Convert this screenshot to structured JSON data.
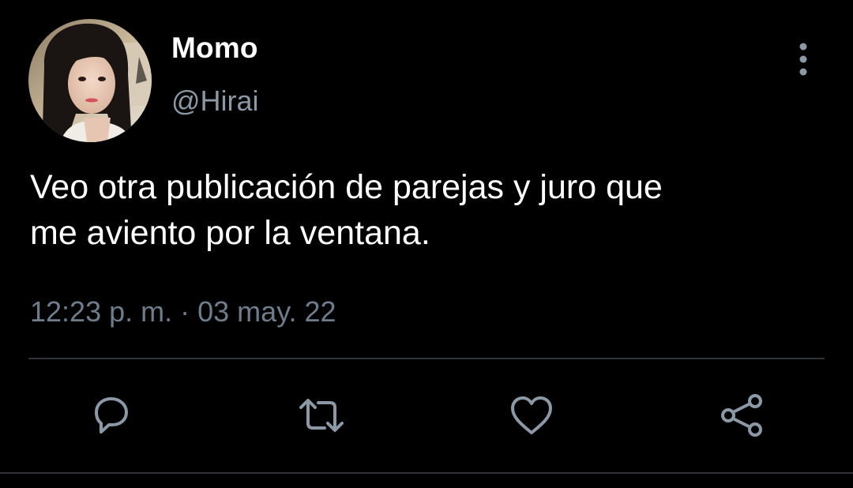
{
  "user": {
    "display_name": "Momo",
    "handle": "@Hirai"
  },
  "tweet": {
    "text": "Veo otra publicación de parejas y juro que\nme aviento por la ventana.",
    "time": "12:23 p. m.",
    "separator": "·",
    "date": "03 may. 22"
  },
  "actions": [
    {
      "name": "reply",
      "icon": "reply-icon"
    },
    {
      "name": "retweet",
      "icon": "retweet-icon"
    },
    {
      "name": "like",
      "icon": "heart-icon"
    },
    {
      "name": "share",
      "icon": "share-icon"
    }
  ],
  "colors": {
    "background": "#000000",
    "text": "#ffffff",
    "secondary_text": "#8b98a5",
    "icon": "#8b98a5",
    "divider": "#2f3336"
  }
}
